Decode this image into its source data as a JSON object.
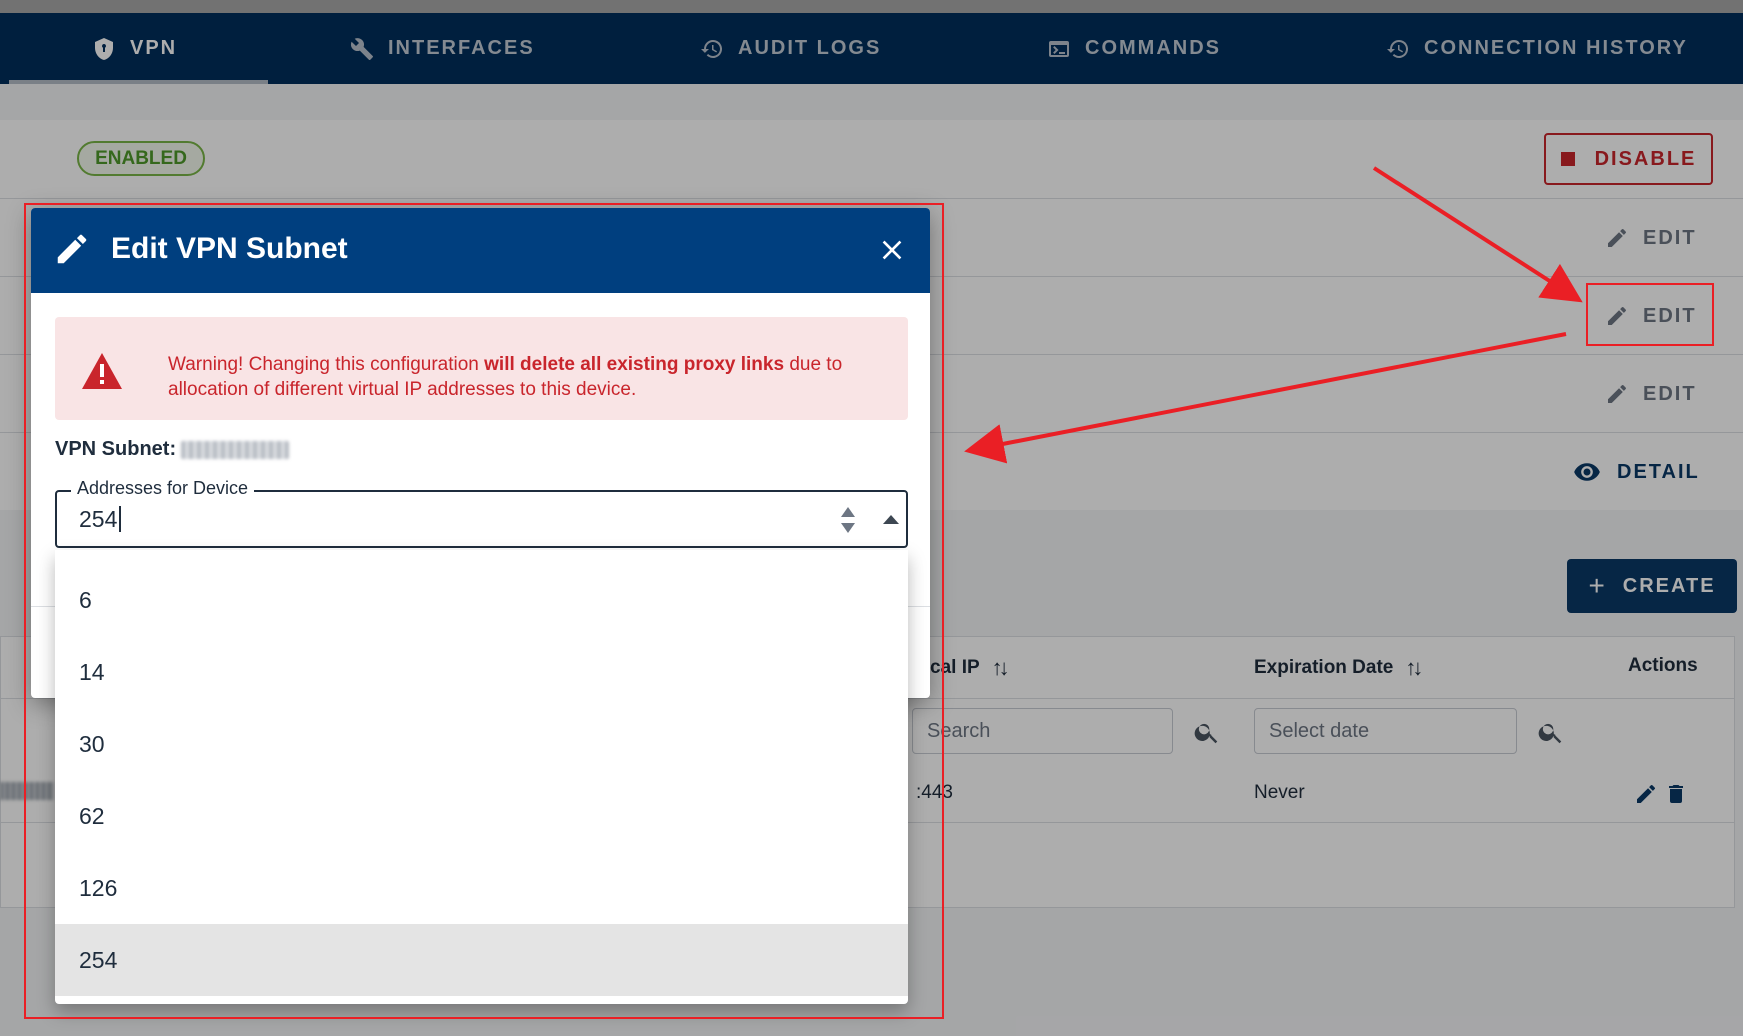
{
  "nav": {
    "tabs": [
      {
        "label": "VPN",
        "icon": "shield-icon",
        "active": true
      },
      {
        "label": "INTERFACES",
        "icon": "wrench-icon",
        "active": false
      },
      {
        "label": "AUDIT LOGS",
        "icon": "history-icon",
        "active": false
      },
      {
        "label": "COMMANDS",
        "icon": "terminal-icon",
        "active": false
      },
      {
        "label": "CONNECTION HISTORY",
        "icon": "history-icon",
        "active": false
      }
    ]
  },
  "vpn": {
    "status_badge": "ENABLED",
    "disable_label": "DISABLE",
    "edit_label": "EDIT",
    "detail_label": "DETAIL"
  },
  "links": {
    "create_label": "CREATE",
    "columns": {
      "local_ip": "cal IP",
      "expiration": "Expiration Date",
      "actions": "Actions"
    },
    "filters": {
      "local_ip_placeholder": "Search",
      "expiration_placeholder": "Select date"
    },
    "row": {
      "local_ip": ":443",
      "expiration": "Never"
    }
  },
  "dialog": {
    "title": "Edit VPN Subnet",
    "warning_prefix": "Warning! Changing this configuration ",
    "warning_bold": "will delete all existing proxy links",
    "warning_suffix": " due to allocation of different virtual IP addresses to this device.",
    "subnet_label": "VPN Subnet:",
    "field_label": "Addresses for Device",
    "field_value": "254",
    "options": [
      "6",
      "14",
      "30",
      "62",
      "126",
      "254"
    ],
    "selected_option": "254"
  },
  "colors": {
    "nav_bg": "#002e5c",
    "dialog_header": "#003f7f",
    "primary": "#0a3866",
    "danger": "#c9252c",
    "success": "#4f9a2a",
    "annotation": "#ea1f25"
  }
}
